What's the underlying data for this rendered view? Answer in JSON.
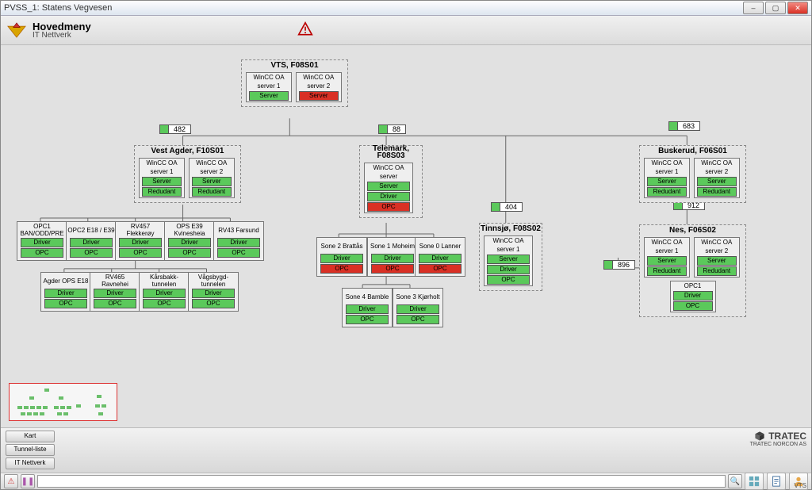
{
  "window": {
    "title": "PVSS_1: Statens Vegvesen"
  },
  "header": {
    "title": "Hovedmeny",
    "subtitle": "IT Nettverk"
  },
  "warning_icon": "warning-triangle",
  "counters": {
    "c1": "482",
    "c2": "88",
    "c3": "404",
    "c4": "683",
    "c5": "912",
    "c6": "896"
  },
  "groups": {
    "vts": {
      "title": "VTS, F08S01",
      "srv1": {
        "t1": "WinCC OA",
        "t2": "server 1",
        "pills": [
          {
            "label": "Server",
            "c": "g"
          }
        ]
      },
      "srv2": {
        "t1": "WinCC OA",
        "t2": "server 2",
        "pills": [
          {
            "label": "Server",
            "c": "r"
          }
        ]
      }
    },
    "vest": {
      "title": "Vest Agder, F10S01",
      "srv1": {
        "t1": "WinCC OA",
        "t2": "server 1",
        "pills": [
          {
            "label": "Server",
            "c": "g"
          },
          {
            "label": "Redudant",
            "c": "g"
          }
        ]
      },
      "srv2": {
        "t1": "WinCC OA",
        "t2": "server 2",
        "pills": [
          {
            "label": "Server",
            "c": "g"
          },
          {
            "label": "Redudant",
            "c": "g"
          }
        ]
      }
    },
    "tele": {
      "title": "Telemark, F08S03",
      "srv": {
        "t1": "WinCC OA",
        "t2": "server",
        "pills": [
          {
            "label": "Server",
            "c": "g"
          },
          {
            "label": "Driver",
            "c": "g"
          },
          {
            "label": "OPC",
            "c": "r"
          }
        ]
      }
    },
    "tinn": {
      "title": "Tinnsjø, F08S02",
      "srv": {
        "t1": "WinCC OA",
        "t2": "server 1",
        "pills": [
          {
            "label": "Server",
            "c": "g"
          },
          {
            "label": "Driver",
            "c": "g"
          },
          {
            "label": "OPC",
            "c": "g"
          }
        ]
      }
    },
    "busk": {
      "title": "Buskerud, F06S01",
      "srv1": {
        "t1": "WinCC OA",
        "t2": "server 1",
        "pills": [
          {
            "label": "Server",
            "c": "g"
          },
          {
            "label": "Redudant",
            "c": "g"
          }
        ]
      },
      "srv2": {
        "t1": "WinCC OA",
        "t2": "server 2",
        "pills": [
          {
            "label": "Server",
            "c": "g"
          },
          {
            "label": "Redudant",
            "c": "g"
          }
        ]
      }
    },
    "nes": {
      "title": "Nes, F06S02",
      "srv1": {
        "t1": "WinCC OA",
        "t2": "server 1",
        "pills": [
          {
            "label": "Server",
            "c": "g"
          },
          {
            "label": "Redudant",
            "c": "g"
          }
        ]
      },
      "srv2": {
        "t1": "WinCC OA",
        "t2": "server 2",
        "pills": [
          {
            "label": "Server",
            "c": "g"
          },
          {
            "label": "Redudant",
            "c": "g"
          }
        ]
      }
    }
  },
  "units": {
    "u_opc1": {
      "title": "OPC1 BAN/ODD/PRE",
      "pills": [
        {
          "label": "Driver",
          "c": "g"
        },
        {
          "label": "OPC",
          "c": "g"
        }
      ]
    },
    "u_opc2": {
      "title": "OPC2 E18 / E39",
      "pills": [
        {
          "label": "Driver",
          "c": "g"
        },
        {
          "label": "OPC",
          "c": "g"
        }
      ]
    },
    "u_flekk": {
      "title": "RV457 Flekkerøy",
      "pills": [
        {
          "label": "Driver",
          "c": "g"
        },
        {
          "label": "OPC",
          "c": "g"
        }
      ]
    },
    "u_kvin": {
      "title": "OPS E39 Kvinesheia",
      "pills": [
        {
          "label": "Driver",
          "c": "g"
        },
        {
          "label": "OPC",
          "c": "g"
        }
      ]
    },
    "u_fars": {
      "title": "RV43 Farsund",
      "pills": [
        {
          "label": "Driver",
          "c": "g"
        },
        {
          "label": "OPC",
          "c": "g"
        }
      ]
    },
    "u_agder": {
      "title": "Agder OPS E18",
      "pills": [
        {
          "label": "Driver",
          "c": "g"
        },
        {
          "label": "OPC",
          "c": "g"
        }
      ]
    },
    "u_ravn": {
      "title": "RV465 Ravnehei",
      "pills": [
        {
          "label": "Driver",
          "c": "g"
        },
        {
          "label": "OPC",
          "c": "g"
        }
      ]
    },
    "u_kars": {
      "title": "Kårsbakk-tunnelen",
      "pills": [
        {
          "label": "Driver",
          "c": "g"
        },
        {
          "label": "OPC",
          "c": "g"
        }
      ]
    },
    "u_vags": {
      "title": "Vågsbygd-tunnelen",
      "pills": [
        {
          "label": "Driver",
          "c": "g"
        },
        {
          "label": "OPC",
          "c": "g"
        }
      ]
    },
    "u_s2": {
      "title": "Sone 2 Brattås",
      "pills": [
        {
          "label": "Driver",
          "c": "g"
        },
        {
          "label": "OPC",
          "c": "r"
        }
      ]
    },
    "u_s1": {
      "title": "Sone 1 Moheim",
      "pills": [
        {
          "label": "Driver",
          "c": "g"
        },
        {
          "label": "OPC",
          "c": "r"
        }
      ]
    },
    "u_s0": {
      "title": "Sone 0 Lanner",
      "pills": [
        {
          "label": "Driver",
          "c": "g"
        },
        {
          "label": "OPC",
          "c": "r"
        }
      ]
    },
    "u_s4": {
      "title": "Sone 4 Bamble",
      "pills": [
        {
          "label": "Driver",
          "c": "g"
        },
        {
          "label": "OPC",
          "c": "g"
        }
      ]
    },
    "u_s3": {
      "title": "Sone 3 Kjørholt",
      "pills": [
        {
          "label": "Driver",
          "c": "g"
        },
        {
          "label": "OPC",
          "c": "g"
        }
      ]
    },
    "u_nopc1": {
      "title": "OPC1",
      "pills": [
        {
          "label": "Driver",
          "c": "g"
        },
        {
          "label": "OPC",
          "c": "g"
        }
      ]
    }
  },
  "toolbar": {
    "b1": "Kart",
    "b2": "Tunnel-liste",
    "b3": "IT Nettverk"
  },
  "brand": {
    "name": "TRATEC",
    "sub": "TRATEC NORCON AS"
  },
  "status": {
    "warn": "!",
    "purple": "❚❚"
  },
  "footer_label": "VTS"
}
